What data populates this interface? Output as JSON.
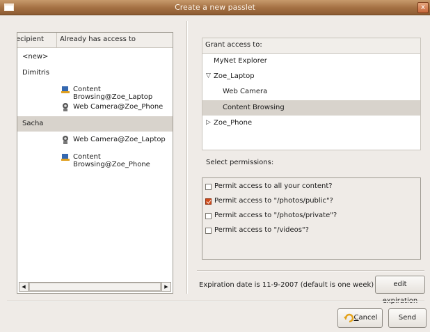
{
  "window": {
    "title": "Create a new passlet",
    "close_glyph": "x"
  },
  "left_panel": {
    "columns": [
      "ecipient",
      "Already has access to"
    ],
    "rows": [
      {
        "recipient": "<new>"
      },
      {
        "recipient": "Dimitris"
      },
      {
        "access": "Content Browsing@Zoe_Laptop",
        "icon": "content-icon"
      },
      {
        "access": "Web Camera@Zoe_Phone",
        "icon": "camera-icon"
      },
      {
        "recipient": "Sacha"
      },
      {
        "access": "Web Camera@Zoe_Laptop",
        "icon": "camera-icon"
      },
      {
        "access": "Content Browsing@Zoe_Phone",
        "icon": "content-icon"
      }
    ]
  },
  "grant": {
    "header": "Grant access to:",
    "items": [
      "MyNet Explorer",
      "Zoe_Laptop",
      "Web Camera",
      "Content Browsing",
      "Zoe_Phone"
    ]
  },
  "permissions": {
    "label": "Select permissions:",
    "items": [
      {
        "label": "Permit access to all your content?",
        "checked": false
      },
      {
        "label": "Permit access to \"/photos/public\"?",
        "checked": true
      },
      {
        "label": "Permit access to \"/photos/private\"?",
        "checked": false
      },
      {
        "label": "Permit access to \"/videos\"?",
        "checked": false
      }
    ]
  },
  "expiration": {
    "text": "Expiration date is 11-9-2007 (default is one week)",
    "button": "edit expiration"
  },
  "buttons": {
    "cancel_mnemonic": "C",
    "cancel_rest": "ancel",
    "send": "Send"
  },
  "colors": {
    "titlebar": "#a36f42",
    "selection": "#d8d3cc",
    "checked": "#d04a1a"
  }
}
